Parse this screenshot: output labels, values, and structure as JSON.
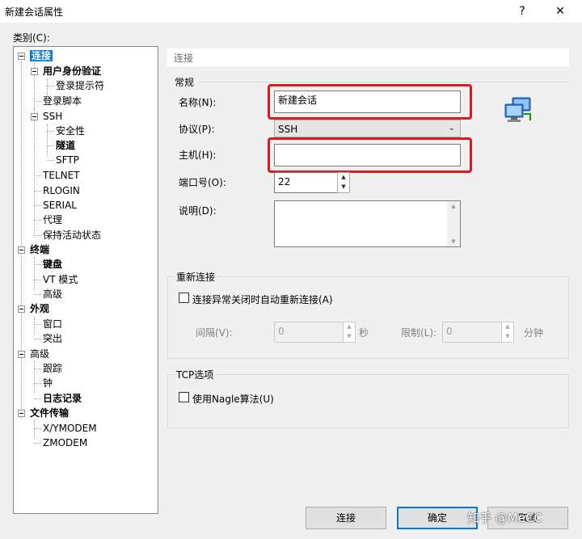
{
  "window": {
    "title": "新建会话属性",
    "help_glyph": "?",
    "close_glyph": "✕"
  },
  "category_label": "类别(C):",
  "tree": {
    "items": [
      {
        "label": "连接",
        "bold": true,
        "selected": true
      },
      {
        "label": "用户身份验证",
        "bold": true
      },
      {
        "label": "登录提示符"
      },
      {
        "label": "登录脚本"
      },
      {
        "label": "SSH"
      },
      {
        "label": "安全性"
      },
      {
        "label": "隧道",
        "bold": true
      },
      {
        "label": "SFTP"
      },
      {
        "label": "TELNET"
      },
      {
        "label": "RLOGIN"
      },
      {
        "label": "SERIAL"
      },
      {
        "label": "代理"
      },
      {
        "label": "保持活动状态"
      },
      {
        "label": "终端",
        "bold": true
      },
      {
        "label": "键盘",
        "bold": true
      },
      {
        "label": "VT 模式"
      },
      {
        "label": "高级"
      },
      {
        "label": "外观",
        "bold": true
      },
      {
        "label": "窗口"
      },
      {
        "label": "突出"
      },
      {
        "label": "高级"
      },
      {
        "label": "跟踪"
      },
      {
        "label": "钟"
      },
      {
        "label": "日志记录",
        "bold": true
      },
      {
        "label": "文件传输",
        "bold": true
      },
      {
        "label": "X/YMODEM"
      },
      {
        "label": "ZMODEM"
      }
    ]
  },
  "page_header": "连接",
  "general": {
    "title": "常规",
    "name_label": "名称(N):",
    "name_value": "新建会话",
    "protocol_label": "协议(P):",
    "protocol_value": "SSH",
    "host_label": "主机(H):",
    "host_value": "",
    "port_label": "端口号(O):",
    "port_value": "22",
    "desc_label": "说明(D):",
    "desc_value": ""
  },
  "reconnect": {
    "title": "重新连接",
    "checkbox_label": "连接异常关闭时自动重新连接(A)",
    "interval_label": "间隔(V):",
    "interval_value": "0",
    "interval_unit": "秒",
    "limit_label": "限制(L):",
    "limit_value": "0",
    "limit_unit": "分钟"
  },
  "tcp": {
    "title": "TCP选项",
    "checkbox_label": "使用Nagle算法(U)"
  },
  "buttons": {
    "connect": "连接",
    "ok": "确定",
    "cancel": "取消"
  },
  "watermark": "知乎 @MeCC",
  "colors": {
    "selection": "#0078d7",
    "highlight_red": "#e0181f",
    "default_button_border": "#0078d7"
  }
}
